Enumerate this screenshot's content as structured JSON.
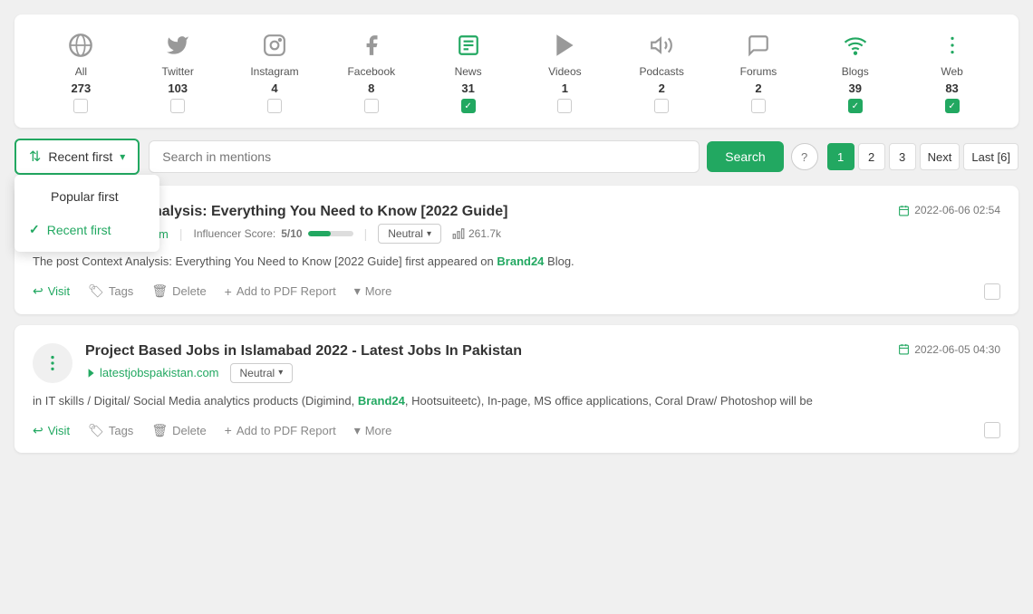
{
  "sources": [
    {
      "id": "all",
      "label": "All",
      "count": "273",
      "icon": "🌐",
      "active": false,
      "checked": false
    },
    {
      "id": "twitter",
      "label": "Twitter",
      "count": "103",
      "icon": "𝕏",
      "active": false,
      "checked": false
    },
    {
      "id": "instagram",
      "label": "Instagram",
      "count": "4",
      "icon": "📷",
      "active": false,
      "checked": false
    },
    {
      "id": "facebook",
      "label": "Facebook",
      "count": "8",
      "icon": "f",
      "active": false,
      "checked": false
    },
    {
      "id": "news",
      "label": "News",
      "count": "31",
      "icon": "≡",
      "active": true,
      "checked": true
    },
    {
      "id": "videos",
      "label": "Videos",
      "count": "1",
      "icon": "▶",
      "active": false,
      "checked": false
    },
    {
      "id": "podcasts",
      "label": "Podcasts",
      "count": "2",
      "icon": "🔊",
      "active": false,
      "checked": false
    },
    {
      "id": "forums",
      "label": "Forums",
      "count": "2",
      "icon": "💬",
      "active": false,
      "checked": false
    },
    {
      "id": "blogs",
      "label": "Blogs",
      "count": "39",
      "icon": "📡",
      "active": true,
      "checked": true
    },
    {
      "id": "web",
      "label": "Web",
      "count": "83",
      "icon": "⋮",
      "active": true,
      "checked": true
    }
  ],
  "toolbar": {
    "sort_label": "Recent first",
    "search_placeholder": "Search in mentions",
    "search_btn": "Search",
    "help_label": "?",
    "pagination": {
      "pages": [
        "1",
        "2",
        "3"
      ],
      "next": "Next",
      "last": "Last [6]",
      "active": "1"
    }
  },
  "sort_options": [
    {
      "id": "popular",
      "label": "Popular first",
      "selected": false
    },
    {
      "id": "recent",
      "label": "Recent first",
      "selected": true
    }
  ],
  "cards": [
    {
      "id": "card1",
      "icon": "≡",
      "icon_color": "green",
      "title": "Context Analysis: Everything You Need to Know [2022 Guide]",
      "source": "brand24.com",
      "source_icon": "◀",
      "influencer_score": "5/10",
      "score_percent": 50,
      "sentiment": "Neutral",
      "reach": "261.7k",
      "date": "2022-06-06 02:54",
      "body": "The post Context Analysis: Everything You Need to Know [2022 Guide] first appeared on ",
      "body_link": "Brand24",
      "body_suffix": " Blog.",
      "actions": [
        {
          "id": "visit",
          "label": "Visit",
          "icon": "↩"
        },
        {
          "id": "tags",
          "label": "Tags",
          "icon": "🏷"
        },
        {
          "id": "delete",
          "label": "Delete",
          "icon": "🗑"
        },
        {
          "id": "add-pdf",
          "label": "Add to PDF Report",
          "icon": "+"
        },
        {
          "id": "more",
          "label": "More",
          "icon": "▾"
        }
      ]
    },
    {
      "id": "card2",
      "icon": "⋮",
      "icon_color": "green",
      "title": "Project Based Jobs in Islamabad 2022 - Latest Jobs In Pakistan",
      "source": "latestjobspakistan.com",
      "source_icon": "◀",
      "influencer_score": null,
      "sentiment": "Neutral",
      "reach": null,
      "date": "2022-06-05 04:30",
      "body": "in IT skills / Digital/ Social Media analytics products (Digimind, ",
      "body_highlight": "Brand24",
      "body_suffix": ", Hootsuiteetc), In-page, MS office applications, Coral Draw/ Photoshop will be",
      "actions": [
        {
          "id": "visit",
          "label": "Visit",
          "icon": "↩"
        },
        {
          "id": "tags",
          "label": "Tags",
          "icon": "🏷"
        },
        {
          "id": "delete",
          "label": "Delete",
          "icon": "🗑"
        },
        {
          "id": "add-pdf",
          "label": "Add to PDF Report",
          "icon": "+"
        },
        {
          "id": "more",
          "label": "More",
          "icon": "▾"
        }
      ]
    }
  ]
}
